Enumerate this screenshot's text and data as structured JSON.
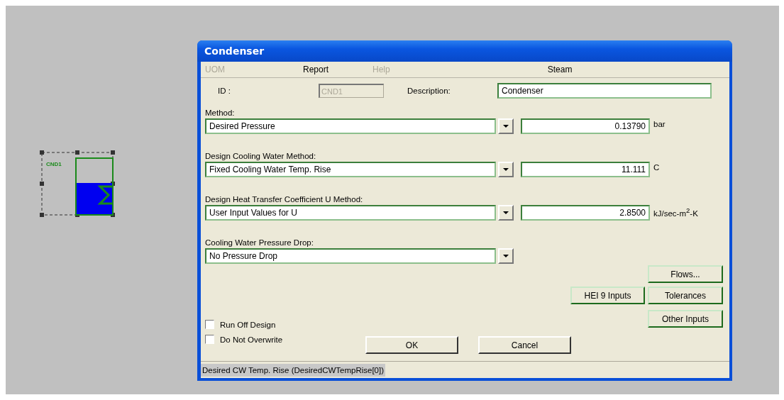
{
  "canvas": {
    "block": {
      "tag": "CND1"
    }
  },
  "window": {
    "title": "Condenser"
  },
  "menu": [
    {
      "label": "UOM",
      "disabled": true
    },
    {
      "label": "Report",
      "disabled": false
    },
    {
      "label": "Help",
      "disabled": true
    },
    {
      "label": "Steam",
      "disabled": false
    }
  ],
  "id_field": {
    "label": "ID :",
    "value": "CND1",
    "disabled": true
  },
  "description": {
    "label": "Description:",
    "value": "Condenser"
  },
  "settings": [
    {
      "label": "Method:",
      "choice": "Desired Pressure",
      "value": "0.13790",
      "unit": "bar"
    },
    {
      "label": "Design Cooling Water Method:",
      "choice": "Fixed Cooling Water Temp. Rise",
      "value": "11.111",
      "unit": "C"
    },
    {
      "label": "Design Heat Transfer Coefficient U Method:",
      "choice": "User Input Values for U",
      "value": "2.8500",
      "unit": "kJ/sec-m$^{2}$-K"
    },
    {
      "label": "Cooling Water Pressure Drop:",
      "choice": "No Pressure Drop"
    }
  ],
  "side_buttons": [
    {
      "label": "Flows..."
    },
    {
      "label": "HEI 9 Inputs"
    },
    {
      "label": "Tolerances"
    },
    {
      "label": "Other Inputs"
    }
  ],
  "checkboxes": [
    {
      "label": "Run Off Design",
      "checked": false
    },
    {
      "label": "Do Not Overwrite",
      "checked": false
    }
  ],
  "dialog_buttons": [
    {
      "label": "OK"
    },
    {
      "label": "Cancel"
    }
  ],
  "status_bar": "Desired CW Temp. Rise (DesiredCWTempRise[0])"
}
